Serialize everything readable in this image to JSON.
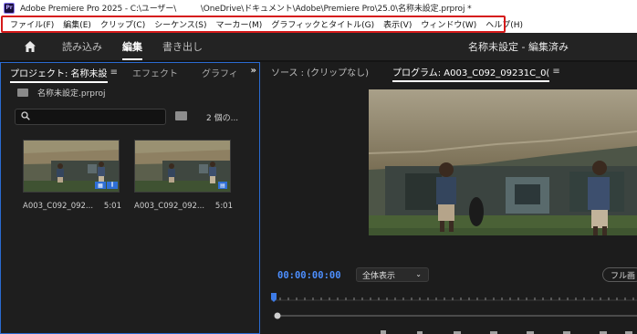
{
  "titlebar": {
    "app_icon": "Pr",
    "title": "Adobe Premiere Pro 2025 - C:\\ユーザー\\　　　\\OneDrive\\ドキュメント\\Adobe\\Premiere Pro\\25.0\\名称未設定.prproj *"
  },
  "menubar": {
    "items": [
      "ファイル(F)",
      "編集(E)",
      "クリップ(C)",
      "シーケンス(S)",
      "マーカー(M)",
      "グラフィックとタイトル(G)",
      "表示(V)",
      "ウィンドウ(W)",
      "ヘルプ(H)"
    ],
    "highlight_color": "#d51a1a"
  },
  "workspace": {
    "home_icon": "home-icon",
    "tabs": [
      "読み込み",
      "編集",
      "書き出し"
    ],
    "active_tab": "編集",
    "project_status": "名称未設定 - 編集済み"
  },
  "project_panel": {
    "tabs": [
      "プロジェクト: 名称未設",
      "エフェクト",
      "グラフィ"
    ],
    "project_file": "名称未設定.prproj",
    "search": {
      "placeholder": ""
    },
    "item_count": "2 個の...",
    "clips": [
      {
        "name": "A003_C092_092...",
        "duration": "5:01"
      },
      {
        "name": "A003_C092_092...",
        "duration": "5:01"
      }
    ]
  },
  "monitor": {
    "source_tab": "ソース : (クリップなし)",
    "program_tab": "プログラム: A003_C092_09231C_0(",
    "timecode": "00:00:00:00",
    "zoom_level": "全体表示",
    "full_button": "フル画"
  },
  "colors": {
    "accent_blue": "#2a6bd1",
    "timecode_blue": "#4d8fff"
  }
}
